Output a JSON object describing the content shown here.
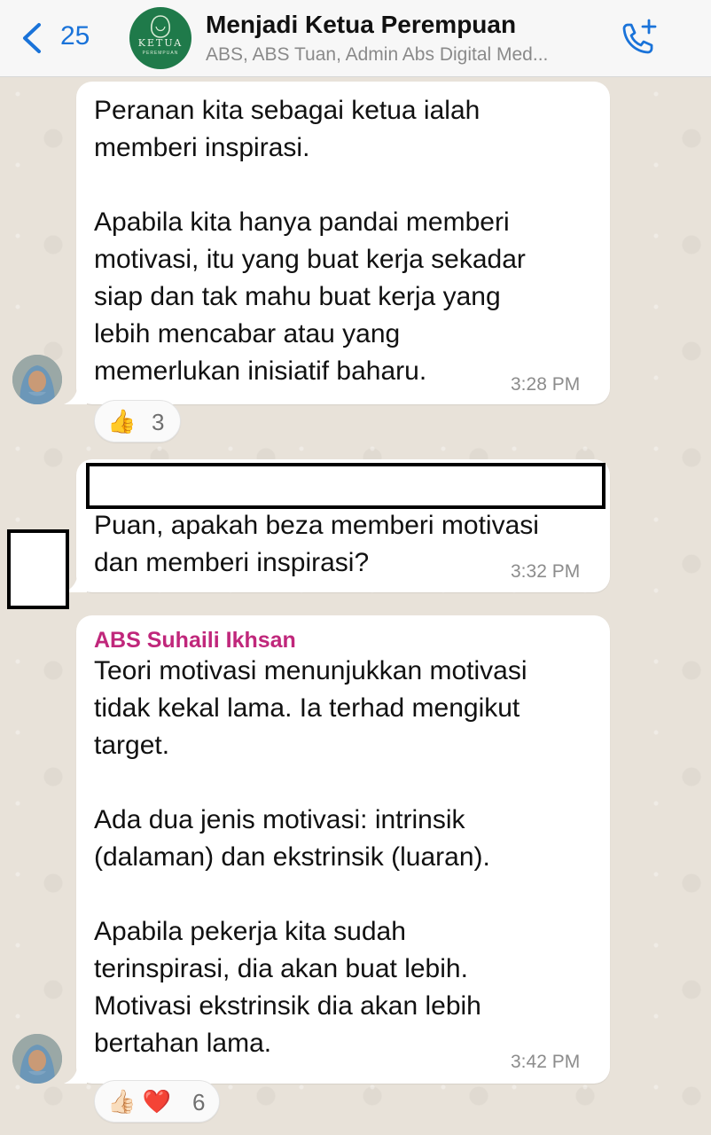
{
  "header": {
    "back_count": "25",
    "group_name": "Menjadi Ketua Perempuan",
    "members": "ABS, ABS Tuan, Admin Abs Digital Med...",
    "logo_text": "KETUA",
    "logo_subtext": "PEREMPUAN"
  },
  "messages": [
    {
      "text": "Peranan kita sebagai ketua ialah\nmemberi inspirasi.\n\nApabila kita hanya pandai memberi\nmotivasi, itu yang buat kerja sekadar\nsiap dan tak mahu buat kerja yang\nlebih mencabar atau yang\nmemerlukan inisiatif baharu.",
      "time": "3:28 PM",
      "reaction_emoji": "👍",
      "reaction_count": "3"
    },
    {
      "text": "Puan, apakah beza memberi motivasi\ndan memberi inspirasi?",
      "time": "3:32 PM"
    },
    {
      "sender": "ABS Suhaili Ikhsan",
      "text": "Teori motivasi menunjukkan motivasi\ntidak kekal lama. Ia terhad mengikut\ntarget.\n\nAda dua jenis motivasi: intrinsik\n(dalaman) dan ekstrinsik (luaran).\n\nApabila pekerja kita sudah\nterinspirasi, dia akan buat lebih.\nMotivasi ekstrinsik dia akan lebih\nbertahan lama.",
      "time": "3:42 PM",
      "reaction_emoji": "👍🏻 ❤️",
      "reaction_count": "6"
    }
  ],
  "colors": {
    "accent": "#1a73d9",
    "sender_name": "#c0277b",
    "bubble": "#ffffff",
    "wallpaper": "#e8e2d9"
  }
}
